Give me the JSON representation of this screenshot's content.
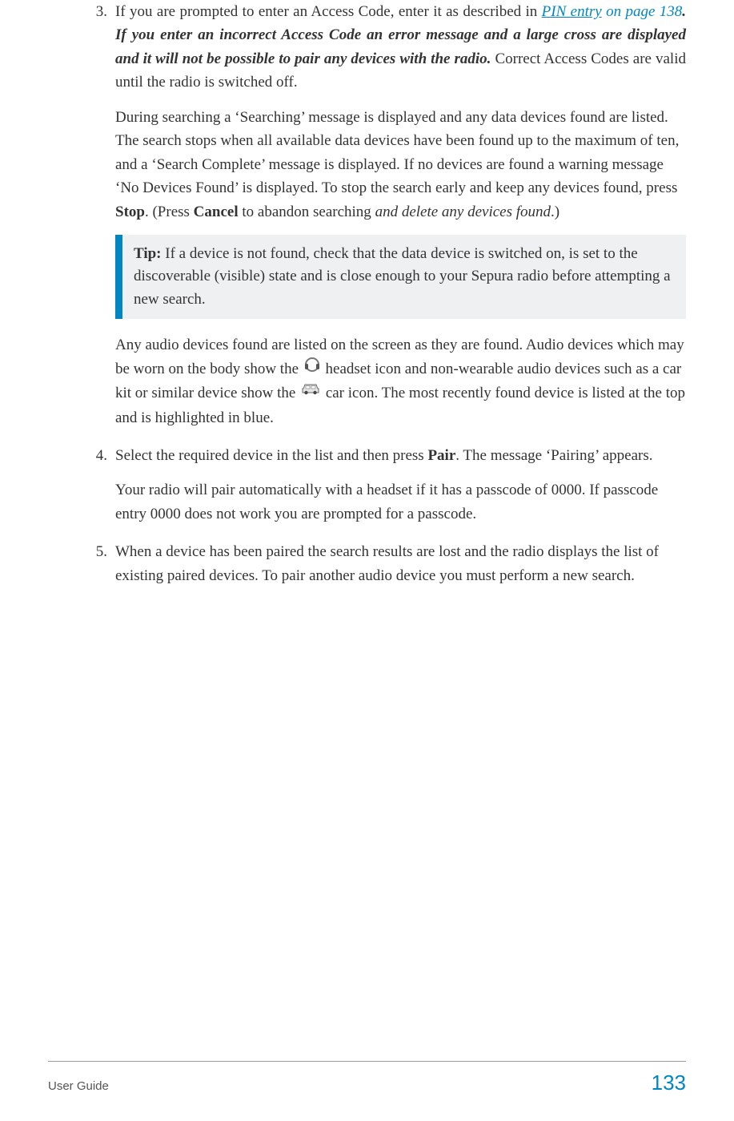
{
  "steps": {
    "s3": {
      "num": "3.",
      "p1_a": "If you are prompted to enter an Access Code, enter it as described in ",
      "p1_link": "PIN entry",
      "p1_linkpage": " on page 138",
      "p1_b": ". If you enter an incorrect Access Code an error message and a large cross are displayed and it will not be possible to pair any devices with the radio.",
      "p1_c": " Correct Access Codes are valid until the radio is switched off.",
      "p2_a": "During searching a ‘Searching’ message is displayed and any data devices found are listed. The search stops when all available data devices have been found up to the maximum of ten, and a ‘Search Complete’ message is displayed. If no devices are found a warning message ‘No Devices Found’ is displayed. To stop the search early and keep any devices found, press ",
      "p2_stop": "Stop",
      "p2_b": ". (Press ",
      "p2_cancel": "Cancel",
      "p2_c": " to abandon searching ",
      "p2_italic": "and delete any devices found",
      "p2_d": ".)",
      "tip_label": "Tip:",
      "tip_body": "  If a device is not found, check that the data device is switched on, is set to the discoverable (visible) state and is close enough to your Sepura radio before attempting a new search.",
      "p3_a": "Any audio devices found are listed on the screen as they are found. Audio devices which may be worn on the body show the ",
      "p3_b": " headset icon and non-wearable audio devices such as a car kit or similar device show the ",
      "p3_c": " car icon. The most recently found device is listed at the top and is highlighted in blue."
    },
    "s4": {
      "num": "4.",
      "p1_a": "Select the required device in the list and then press ",
      "p1_pair": "Pair",
      "p1_b": ". The message ‘Pairing’ appears.",
      "p2": "Your radio will pair automatically with a headset if it has a passcode of 0000. If passcode entry 0000 does not work you are prompted for a passcode."
    },
    "s5": {
      "num": "5.",
      "p1": "When a device has been paired the search results are lost and the radio displays the list of existing paired devices. To pair another audio device you must perform a new search."
    }
  },
  "footer": {
    "left": "User Guide",
    "page": "133"
  }
}
